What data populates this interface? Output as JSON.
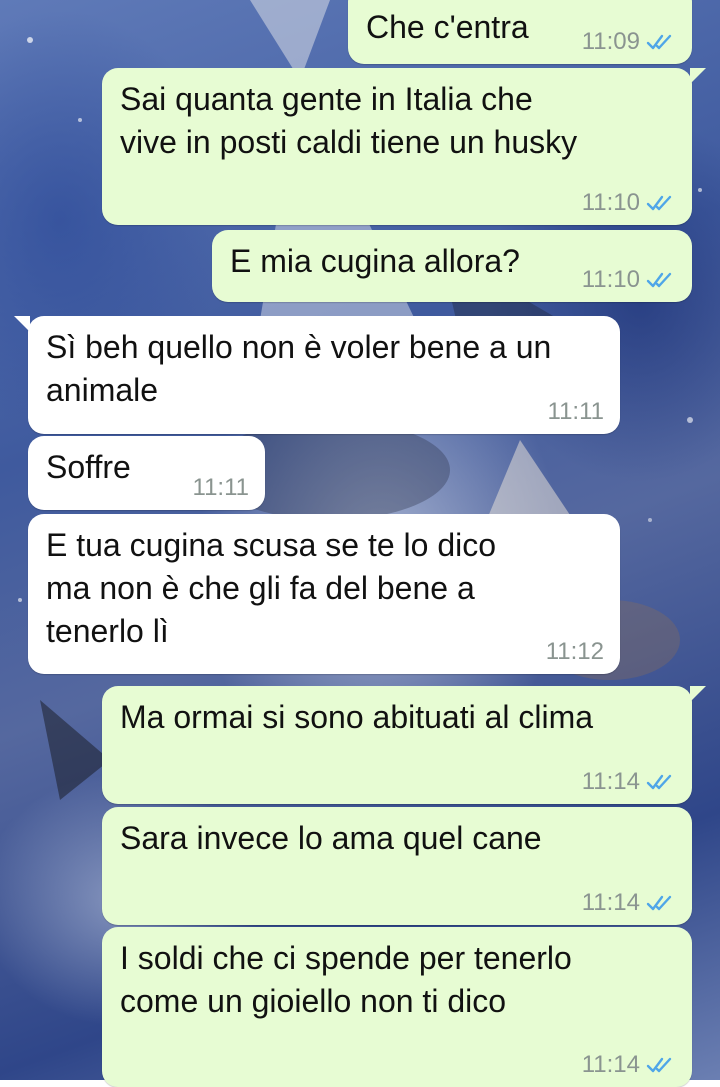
{
  "messages": [
    {
      "id": "m1",
      "direction": "outgoing",
      "text_lines": [
        "Che c'entra"
      ],
      "time": "11:09",
      "status": "read"
    },
    {
      "id": "m2",
      "direction": "outgoing",
      "text_lines": [
        "Sai quanta gente in Italia che",
        "vive in posti caldi tiene un husky"
      ],
      "time": "11:10",
      "status": "read"
    },
    {
      "id": "m3",
      "direction": "outgoing",
      "text_lines": [
        "E mia cugina allora?"
      ],
      "time": "11:10",
      "status": "read"
    },
    {
      "id": "m4",
      "direction": "incoming",
      "text_lines": [
        "Sì beh quello non è voler bene a un",
        "animale"
      ],
      "time": "11:11"
    },
    {
      "id": "m5",
      "direction": "incoming",
      "text_lines": [
        "Soffre"
      ],
      "time": "11:11"
    },
    {
      "id": "m6",
      "direction": "incoming",
      "text_lines": [
        "E tua cugina scusa se te lo dico",
        "ma non è che gli fa del bene a",
        "tenerlo lì"
      ],
      "time": "11:12"
    },
    {
      "id": "m7",
      "direction": "outgoing",
      "text_lines": [
        "Ma ormai si sono abituati al clima"
      ],
      "time": "11:14",
      "status": "read"
    },
    {
      "id": "m8",
      "direction": "outgoing",
      "text_lines": [
        "Sara invece lo ama quel cane"
      ],
      "time": "11:14",
      "status": "read"
    },
    {
      "id": "m9",
      "direction": "outgoing",
      "text_lines": [
        "I soldi che ci spende per tenerlo",
        "come un gioiello non ti dico"
      ],
      "time": "11:14",
      "status": "read"
    }
  ],
  "icons": {
    "read_receipt": "double-check-icon"
  },
  "colors": {
    "outgoing_bubble": "#e7fcd3",
    "incoming_bubble": "#ffffff",
    "read_tick": "#4fa6e8",
    "timestamp": "#8a9490"
  }
}
